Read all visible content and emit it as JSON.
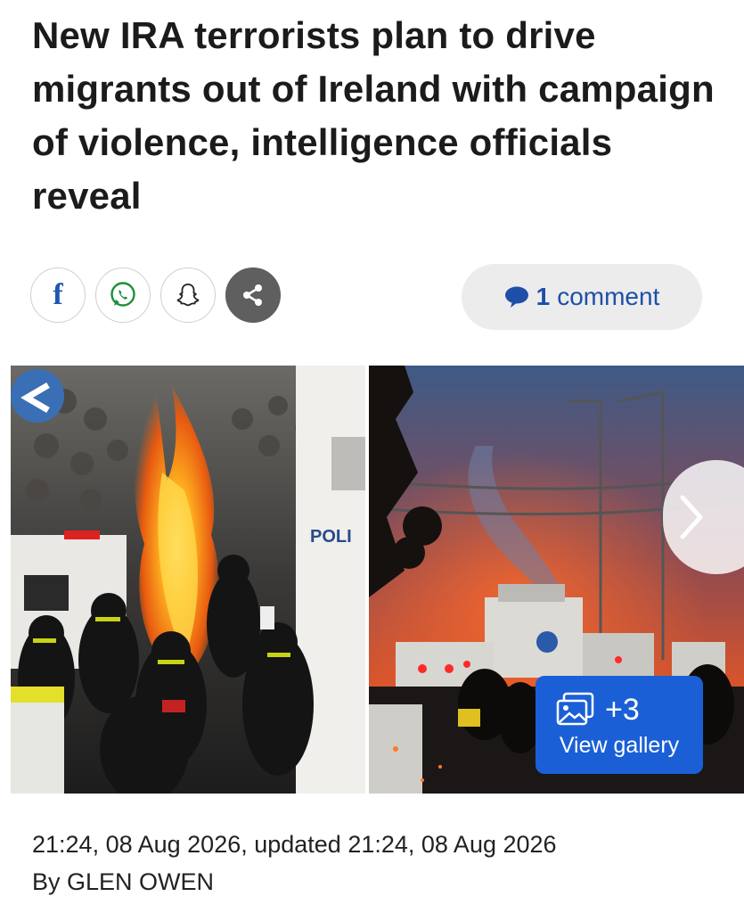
{
  "article": {
    "headline": "New IRA terrorists plan to drive migrants out of Ireland with campaign of violence, intelligence officials reveal",
    "timestamp": "21:24, 08 Aug 2026, updated 21:24, 08 Aug 2026",
    "byline": "By GLEN OWEN"
  },
  "share": {
    "buttons": [
      {
        "name": "facebook",
        "icon": "facebook-icon"
      },
      {
        "name": "whatsapp",
        "icon": "whatsapp-icon"
      },
      {
        "name": "snapchat",
        "icon": "snapchat-icon"
      },
      {
        "name": "more-share",
        "icon": "share-icon"
      }
    ]
  },
  "comments": {
    "count": "1",
    "label": "comment",
    "icon": "speech-bubble-icon",
    "color": "#1e4fa8"
  },
  "gallery": {
    "photo_left_sign": "POLI",
    "badge_count": "+3",
    "badge_label": "View gallery",
    "badge_color": "#1a5fd6",
    "next_icon": "chevron-right-icon"
  }
}
